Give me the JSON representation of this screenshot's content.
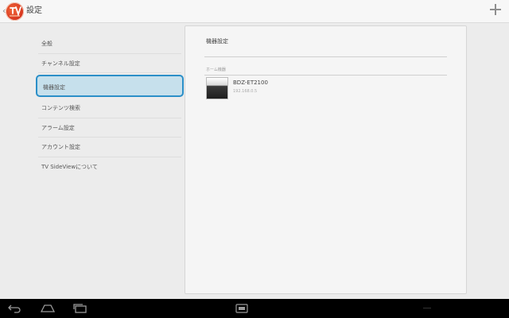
{
  "header": {
    "title": "設定",
    "back_icon": "chevron-left-icon",
    "logo_icon": "tv-sideview-logo-icon",
    "add_icon": "plus-icon"
  },
  "menu": {
    "items": [
      {
        "label": "全般"
      },
      {
        "label": "チャンネル設定"
      },
      {
        "label": "機器設定"
      },
      {
        "label": "コンテンツ検索"
      },
      {
        "label": "アラーム設定"
      },
      {
        "label": "アカウント設定"
      },
      {
        "label": "TV SideViewについて"
      }
    ],
    "selected_index": 2
  },
  "detail": {
    "title": "機器設定",
    "section_label": "ホーム機器",
    "device": {
      "name": "BDZ-ET2100",
      "subtitle": "192.168.0.5"
    }
  },
  "navbar": {
    "icons": [
      "back-icon",
      "home-icon",
      "recent-apps-icon",
      "menu-icon"
    ]
  },
  "colors": {
    "selection_fill": "#c6e0ec",
    "selection_border": "#2b8fc8",
    "logo": "#d5321d"
  }
}
